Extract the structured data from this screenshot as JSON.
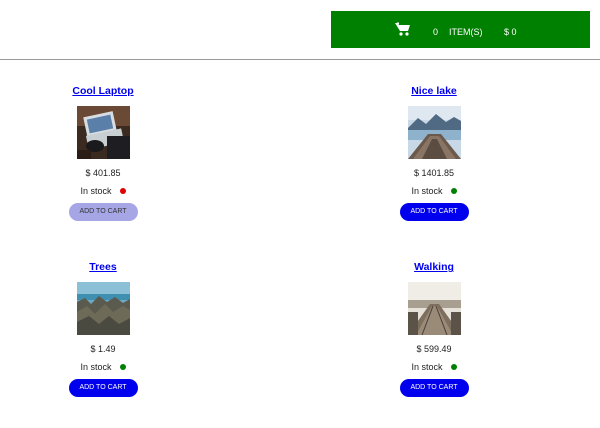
{
  "cart": {
    "icon": "shopping-cart-icon",
    "count": "0",
    "items_label": "ITEM(S)",
    "total": "$ 0",
    "bar_color": "#008000"
  },
  "products": [
    {
      "title": "Cool Laptop",
      "image": "laptop-photo",
      "price": "$ 401.85",
      "stock_label": "In stock",
      "stock_color": "#e00000",
      "button_label": "ADD TO CART",
      "button_color": "#a6a6e6",
      "button_enabled": false
    },
    {
      "title": "Nice lake",
      "image": "lake-photo",
      "price": "$ 1401.85",
      "stock_label": "In stock",
      "stock_color": "#008000",
      "button_label": "ADD TO CART",
      "button_color": "#0000ee",
      "button_enabled": true
    },
    {
      "title": "Trees",
      "image": "trees-photo",
      "price": "$ 1.49",
      "stock_label": "In stock",
      "stock_color": "#008000",
      "button_label": "ADD TO CART",
      "button_color": "#0000ee",
      "button_enabled": true
    },
    {
      "title": "Walking",
      "image": "walking-photo",
      "price": "$ 599.49",
      "stock_label": "In stock",
      "stock_color": "#008000",
      "button_label": "ADD TO CART",
      "button_color": "#0000ee",
      "button_enabled": true
    }
  ]
}
